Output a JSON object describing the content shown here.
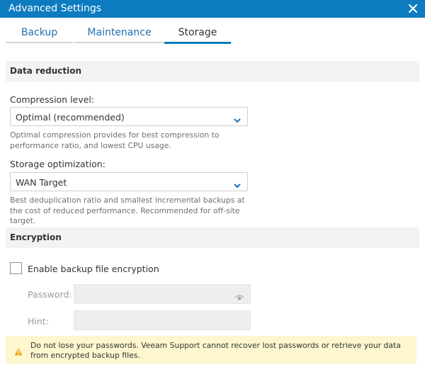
{
  "window": {
    "title": "Advanced Settings",
    "close_icon": "close-icon"
  },
  "tabs": [
    {
      "label": "Backup",
      "active": false
    },
    {
      "label": "Maintenance",
      "active": false
    },
    {
      "label": "Storage",
      "active": true
    }
  ],
  "data_reduction": {
    "header": "Data reduction",
    "compression": {
      "label": "Compression level:",
      "value": "Optimal (recommended)",
      "help": "Optimal compression provides for best compression to performance ratio, and lowest CPU usage."
    },
    "storage_optimization": {
      "label": "Storage optimization:",
      "value": "WAN Target",
      "help": "Best deduplication ratio and smallest incremental backups at the cost of reduced performance. Recommended for off-site target."
    }
  },
  "encryption": {
    "header": "Encryption",
    "enable_label": "Enable backup file encryption",
    "enabled": false,
    "password_label": "Password:",
    "password_value": "",
    "hint_label": "Hint:",
    "hint_value": ""
  },
  "warning": {
    "icon": "warning-icon",
    "color": "#fdf6cf",
    "text": "Do not lose your passwords. Veeam Support cannot recover lost passwords or retrieve your data from encrypted backup files."
  },
  "colors": {
    "accent": "#0c7bbf",
    "link": "#1f6fb0"
  }
}
